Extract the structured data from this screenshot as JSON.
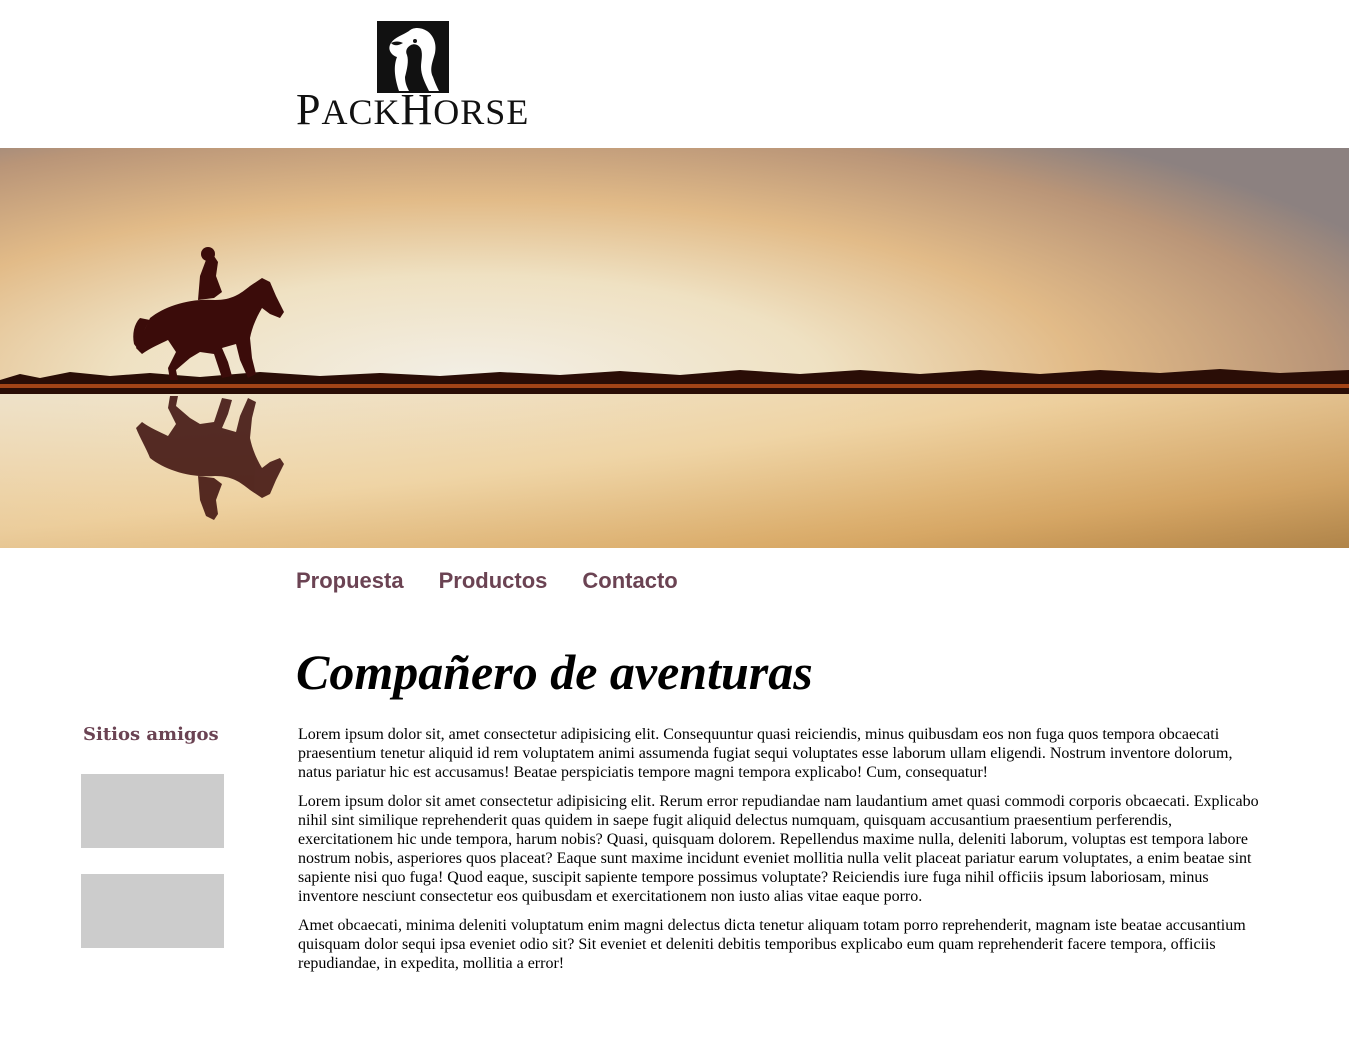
{
  "logo": {
    "text_prefix": "P",
    "text_small_1": "ACK",
    "text_big_2": "H",
    "text_small_2": "ORSE",
    "brand_color": "#111111"
  },
  "hero": {
    "image": "silhouette of a rider on a horse at sunset with reflection on water"
  },
  "nav": {
    "items": [
      {
        "label": "Propuesta"
      },
      {
        "label": "Productos"
      },
      {
        "label": "Contacto"
      }
    ],
    "color": "#6b4353"
  },
  "main": {
    "title": "Compañero de aventuras",
    "paragraphs": [
      "Lorem ipsum dolor sit, amet consectetur adipisicing elit. Consequuntur quasi reiciendis, minus quibusdam eos non fuga quos tempora obcaecati praesentium tenetur aliquid id rem voluptatem animi assumenda fugiat sequi voluptates esse laborum ullam eligendi. Nostrum inventore dolorum, natus pariatur hic est accusamus! Beatae perspiciatis tempore magni tempora explicabo! Cum, consequatur!",
      "Lorem ipsum dolor sit amet consectetur adipisicing elit. Rerum error repudiandae nam laudantium amet quasi commodi corporis obcaecati. Explicabo nihil sint similique reprehenderit quas quidem in saepe fugit aliquid delectus numquam, quisquam accusantium praesentium perferendis, exercitationem hic unde tempora, harum nobis? Quasi, quisquam dolorem. Repellendus maxime nulla, deleniti laborum, voluptas est tempora labore nostrum nobis, asperiores quos placeat? Eaque sunt maxime incidunt eveniet mollitia nulla velit placeat pariatur earum voluptates, a enim beatae sint sapiente nisi quo fuga! Quod eaque, suscipit sapiente tempore possimus voluptate? Reiciendis iure fuga nihil officiis ipsum laboriosam, minus inventore nesciunt consectetur eos quibusdam et exercitationem non iusto alias vitae eaque porro.",
      "Amet obcaecati, minima deleniti voluptatum enim magni delectus dicta tenetur aliquam totam porro reprehenderit, magnam iste beatae accusantium quisquam dolor sequi ipsa eveniet odio sit? Sit eveniet et deleniti debitis temporibus explicabo eum quam reprehenderit facere tempora, officiis repudiandae, in expedita, mollitia a error!"
    ]
  },
  "sidebar": {
    "title": "Sitios amigos",
    "placeholder_color": "#cccccc"
  }
}
